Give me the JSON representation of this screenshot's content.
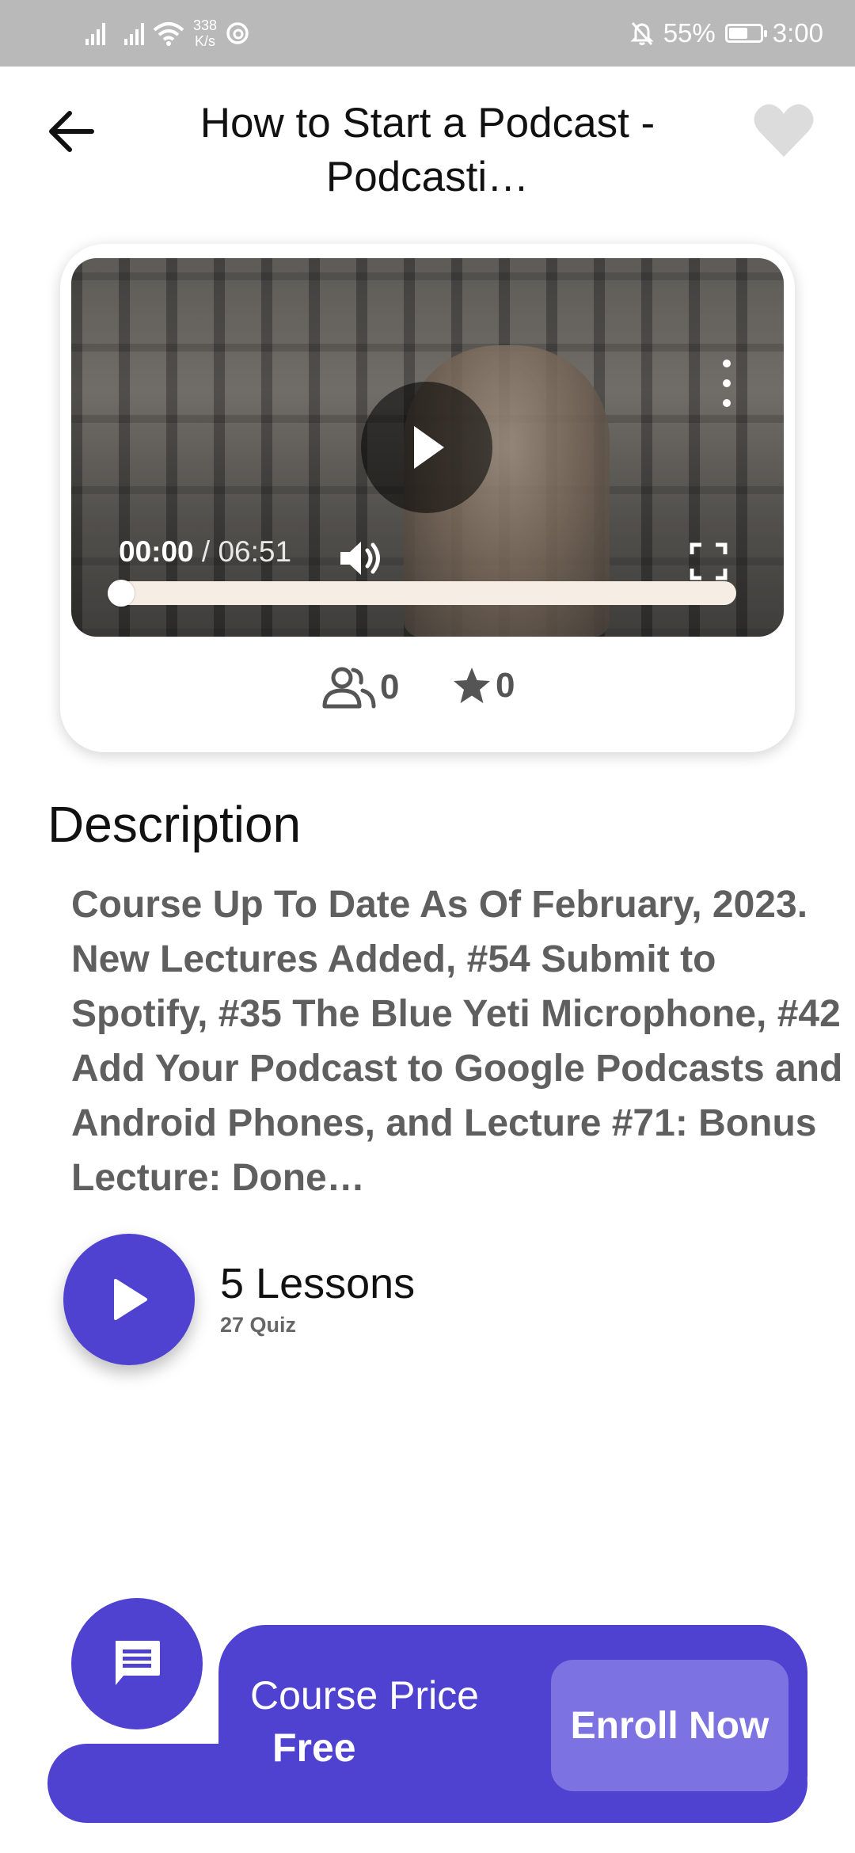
{
  "status_bar": {
    "speed_value": "338",
    "speed_unit": "K/s",
    "battery": "55%",
    "time": "3:00"
  },
  "header": {
    "title": "How to Start a Podcast - Podcasti…"
  },
  "video": {
    "current_time": "00:00",
    "separator": " / ",
    "duration": "06:51",
    "progress": 0
  },
  "stats": {
    "students": "0",
    "rating": "0"
  },
  "description": {
    "heading": "Description",
    "text": "Course Up To Date As Of February, 2023. New Lectures Added, #54 Submit to Spotify, #35 The Blue Yeti Microphone, #42 Add Your Podcast to Google Podcasts and Android Phones, and Lecture #71: Bonus Lecture: Done…"
  },
  "lessons": {
    "title": "5 Lessons",
    "quiz": "27 Quiz"
  },
  "footer": {
    "price_label": "Course Price",
    "price_value": "Free",
    "enroll_label": "Enroll Now"
  },
  "colors": {
    "accent": "#4f42d1",
    "enroll_button": "#7c72e2",
    "status_bar": "#b9b9b9"
  },
  "icons": [
    "back-arrow-icon",
    "heart-icon",
    "play-icon",
    "kebab-menu-icon",
    "volume-icon",
    "fullscreen-icon",
    "users-icon",
    "star-icon",
    "chat-icon"
  ]
}
